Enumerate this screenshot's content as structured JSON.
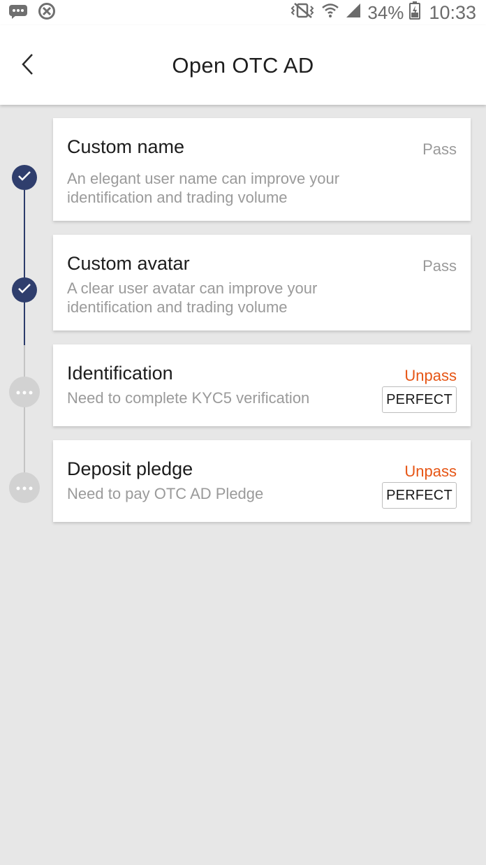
{
  "status_bar": {
    "battery": "34%",
    "time": "10:33"
  },
  "header": {
    "title": "Open OTC AD"
  },
  "steps": [
    {
      "title": "Custom name",
      "status": "Pass",
      "description": "An elegant user name can improve your identification and trading volume"
    },
    {
      "title": "Custom avatar",
      "status": "Pass",
      "description": "A clear user avatar can improve your identification and trading volume"
    },
    {
      "title": "Identification",
      "status": "Unpass",
      "description": "Need to complete KYC5 verification",
      "action": "PERFECT"
    },
    {
      "title": "Deposit pledge",
      "status": "Unpass",
      "description": "Need to pay OTC AD Pledge",
      "action": "PERFECT"
    }
  ],
  "colors": {
    "done": "#2f3e6d",
    "pending": "#d2d2d2",
    "unpass": "#e65515",
    "pass": "#9a9a9a"
  }
}
